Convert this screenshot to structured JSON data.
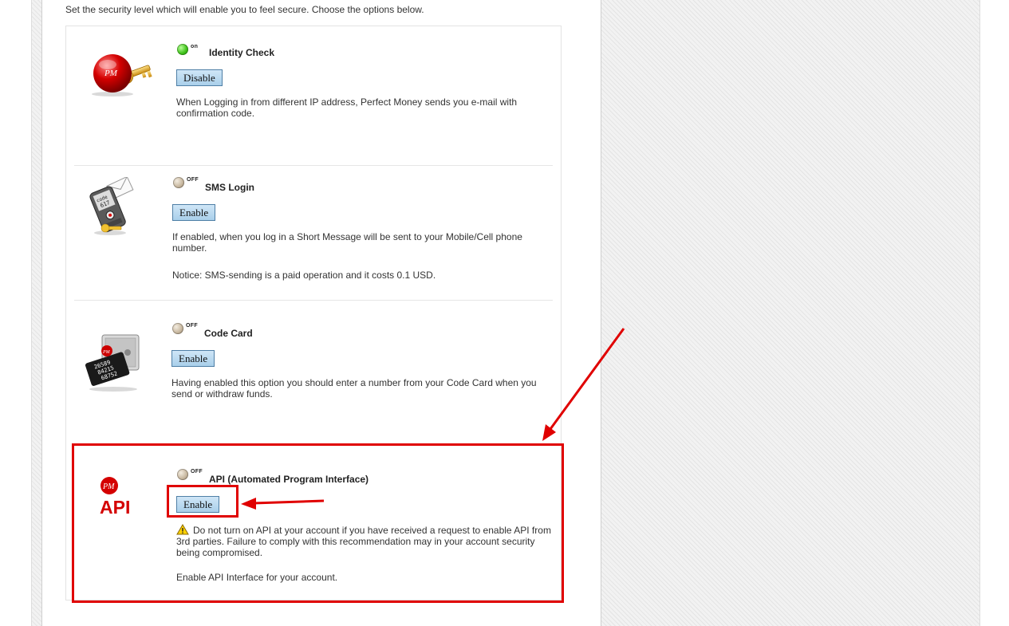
{
  "intro_text": "Set the security level which will enable you to feel secure. Choose the options below.",
  "options": [
    {
      "id": "identity",
      "title": "Identity Check",
      "status": "on",
      "button_label": "Disable",
      "description": "When Logging in from different IP address, Perfect Money sends you e-mail with confirmation code.",
      "icon": "pm-key-icon"
    },
    {
      "id": "sms",
      "title": "SMS Login",
      "status": "OFF",
      "button_label": "Enable",
      "description": "If enabled, when you log in a Short Message will be sent to your Mobile/Cell phone number.",
      "notice": "Notice: SMS-sending is a paid operation and it costs 0.1 USD.",
      "icon": "phone-sms-icon"
    },
    {
      "id": "codecard",
      "title": "Code Card",
      "status": "OFF",
      "button_label": "Enable",
      "description": "Having enabled this option you should enter a number from your Code Card when you send or withdraw funds.",
      "icon": "safe-codecard-icon"
    },
    {
      "id": "api",
      "title": "API (Automated Program Interface)",
      "status": "OFF",
      "button_label": "Enable",
      "warning": "Do not turn on API at your account if you have received a request to enable API from 3rd parties. Failure to comply with this recommendation may in your account security being compromised.",
      "description": "Enable API Interface for your account.",
      "icon": "pm-api-logo",
      "logo_badge": "PM",
      "logo_text": "API"
    }
  ],
  "code_card_digits": [
    "26589",
    "84215",
    "68752"
  ],
  "colors": {
    "highlight": "#e00000",
    "status_on": "#3fc21a",
    "status_off": "#c8b8a0",
    "button_bg": "#b9d9f0",
    "button_border": "#4f7fa6"
  }
}
